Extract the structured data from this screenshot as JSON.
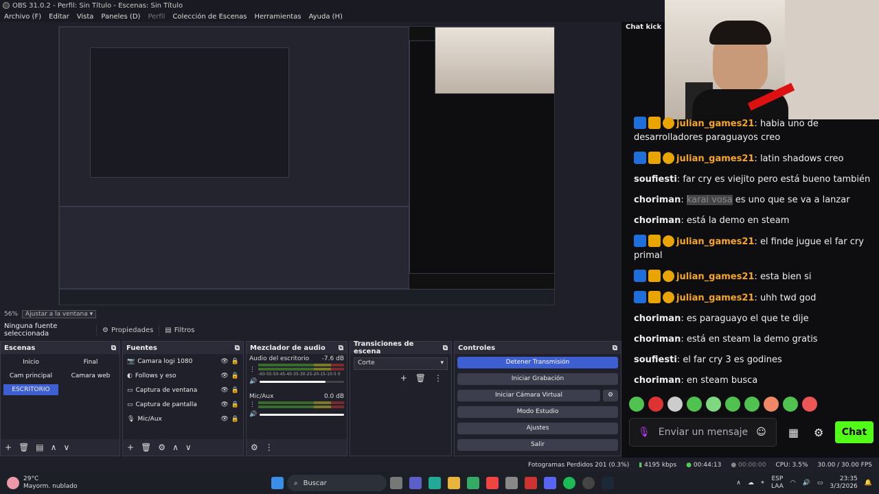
{
  "window": {
    "title": "OBS 31.0.2 - Perfil: Sin Título - Escenas: Sin Título"
  },
  "menu": [
    "Archivo (F)",
    "Editar",
    "Vista",
    "Paneles (D)",
    "Perfil",
    "Colección de Escenas",
    "Herramientas",
    "Ayuda (H)"
  ],
  "zoom": {
    "label": "56%",
    "select": "Ajustar a la ventana"
  },
  "source_toolbar": {
    "selected": "Ninguna fuente seleccionada",
    "props": "Propiedades",
    "filters": "Filtros"
  },
  "scenes": {
    "title": "Escenas",
    "items": [
      "Inicio",
      "Final",
      "Cam principal",
      "Camara web",
      "ESCRITORIO"
    ],
    "selected": "ESCRITORIO"
  },
  "sources": {
    "title": "Fuentes",
    "items": [
      "Camara logi 1080",
      "Follows y eso",
      "Captura de ventana",
      "Captura de pantalla",
      "Mic/Aux"
    ]
  },
  "mixer": {
    "title": "Mezclador de audio",
    "tracks": [
      {
        "name": "Audio del escritorio",
        "db": "-7.6 dB",
        "level": 0.78
      },
      {
        "name": "Mic/Aux",
        "db": "0.0 dB",
        "level": 1.0
      }
    ],
    "scale": "-60-55-50-45-40-35-30-25-20-15-10-5 0"
  },
  "transitions": {
    "title": "Transiciones de escena",
    "selected": "Corte"
  },
  "controls": {
    "title": "Controles",
    "buttons": [
      "Detener Transmisión",
      "Iniciar Grabación",
      "Iniciar Cámara Virtual",
      "Modo Estudio",
      "Ajustes",
      "Salir"
    ]
  },
  "status": {
    "dropped": "Fotogramas Perdidos 201 (0.3%)",
    "bitrate": "4195 kbps",
    "stream_time": "00:44:13",
    "rec_time": "00:00:00",
    "cpu": "CPU: 3.5%",
    "fps": "30.00 / 30.00 FPS"
  },
  "chat": {
    "header": "Chat kick",
    "messages": [
      {
        "user": "julian_games21",
        "badges": true,
        "text": "habia uno de desarrolladores paraguayos creo"
      },
      {
        "user": "julian_games21",
        "badges": true,
        "text": "latin shadows creo"
      },
      {
        "user": "soufiesti",
        "badges": false,
        "text": "far cry es viejito pero está bueno también"
      },
      {
        "user": "choriman",
        "badges": false,
        "redacted": "karai vosa",
        "text": "es uno que se va a lanzar"
      },
      {
        "user": "choriman",
        "badges": false,
        "text": "está la demo en steam"
      },
      {
        "user": "julian_games21",
        "badges": true,
        "text": "el finde jugue el far cry primal"
      },
      {
        "user": "julian_games21",
        "badges": true,
        "text": "esta bien si"
      },
      {
        "user": "julian_games21",
        "badges": true,
        "text": "uhh twd god"
      },
      {
        "user": "choriman",
        "badges": false,
        "text": "es paraguayo el que te dije"
      },
      {
        "user": "choriman",
        "badges": false,
        "text": "está en steam la demo gratis"
      },
      {
        "user": "soufiesti",
        "badges": false,
        "text": "el far cry 3 es godines"
      },
      {
        "user": "choriman",
        "badges": false,
        "text": "en steam busca"
      }
    ],
    "input_placeholder": "Enviar un mensaje",
    "send": "Chat"
  },
  "taskbar": {
    "weather_temp": "29°C",
    "weather_desc": "Mayorm. nublado",
    "search": "Buscar",
    "lang": "ESP",
    "lang2": "LAA",
    "time": "23:35",
    "date": "3/3/2026"
  },
  "colors": {
    "accent": "#3e5fd1",
    "kick_green": "#53fc18",
    "gold_user": "#f5a623"
  }
}
